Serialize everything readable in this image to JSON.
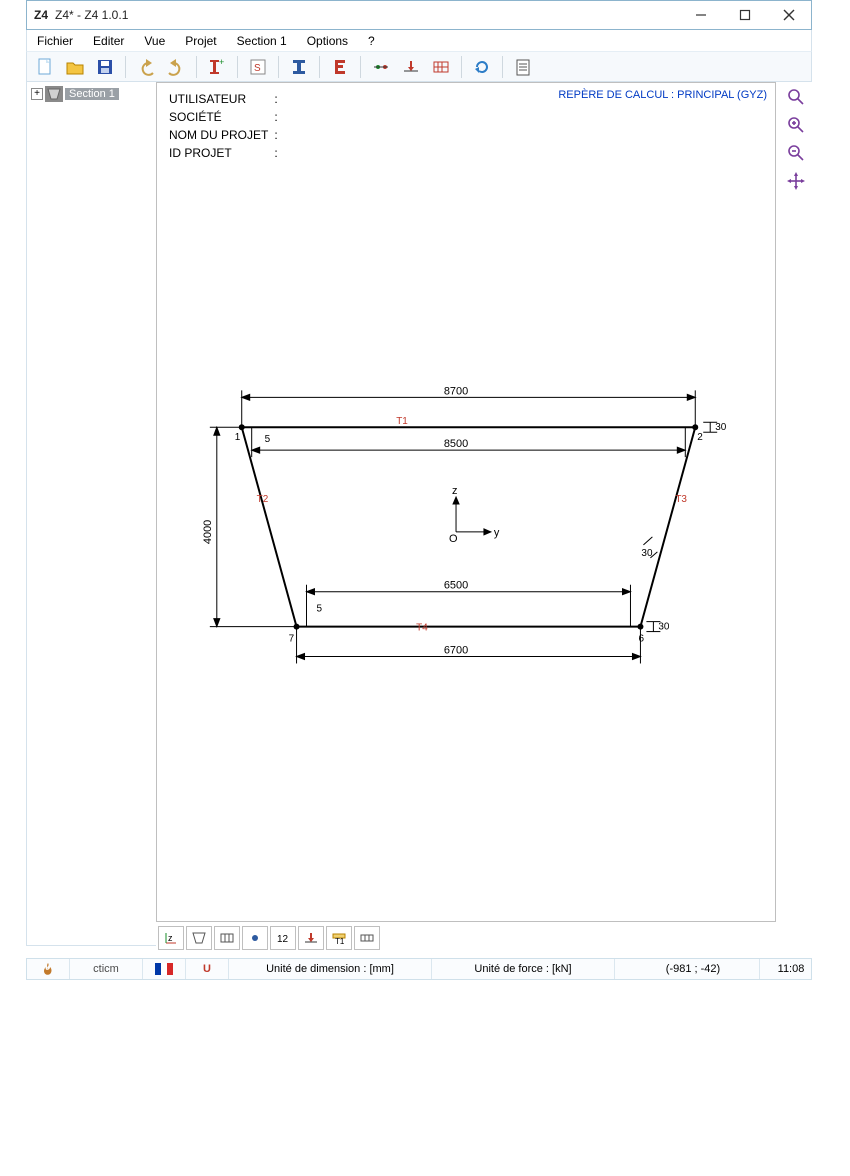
{
  "window": {
    "title": "Z4* - Z4 1.0.1",
    "app_icon_text": "Z4"
  },
  "menu": {
    "items": [
      "Fichier",
      "Editer",
      "Vue",
      "Projet",
      "Section 1",
      "Options",
      "?"
    ]
  },
  "tree": {
    "root_label": "Section 1"
  },
  "info_labels": {
    "user": "UTILISATEUR",
    "company": "SOCIÉTÉ",
    "project_name": "NOM DU PROJET",
    "project_id": "ID PROJET"
  },
  "repere_text": "REPÈRE DE CALCUL : PRINCIPAL (GYZ)",
  "axes": {
    "origin": "O",
    "y": "y",
    "z": "z"
  },
  "dimensions": {
    "top_outer": "8700",
    "top_inner": "8500",
    "bottom_inner": "6500",
    "bottom_outer": "6700",
    "height": "4000",
    "thickness_top": "30",
    "thickness_bottom": "30",
    "web_thickness": "30",
    "radius_top": "5",
    "radius_bottom": "5"
  },
  "plates": {
    "t1": "T1",
    "t2": "T2",
    "t3": "T3",
    "t4": "T4"
  },
  "nodes": {
    "n1": "1",
    "n2": "2",
    "n3": "7",
    "n4": "6"
  },
  "status": {
    "brand": "cticm",
    "u_label": "U",
    "dimension_unit": "Unité de dimension : [mm]",
    "force_unit": "Unité de force : [kN]",
    "coords": "(-981 ; -42)",
    "time": "11:08"
  }
}
